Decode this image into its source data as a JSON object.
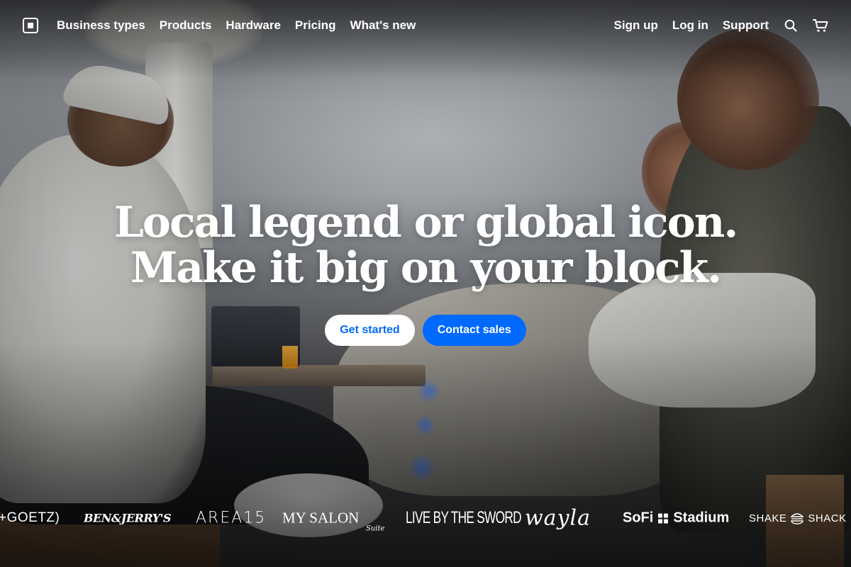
{
  "nav": {
    "logo_name": "square-logo",
    "primary": [
      {
        "label": "Business types"
      },
      {
        "label": "Products"
      },
      {
        "label": "Hardware"
      },
      {
        "label": "Pricing"
      },
      {
        "label": "What's new"
      }
    ],
    "secondary": [
      {
        "label": "Sign up"
      },
      {
        "label": "Log in"
      },
      {
        "label": "Support"
      }
    ],
    "icons": [
      "search-icon",
      "cart-icon"
    ]
  },
  "hero": {
    "headline_line1": "Local legend or global icon.",
    "headline_line2": "Make it big on your block.",
    "cta_primary": "Get started",
    "cta_secondary": "Contact sales"
  },
  "logos": {
    "goetz": "+GOETZ)",
    "benjerry": "BEN&JERRY'S",
    "area15": "AREA15",
    "mysalon": "MY SALON",
    "mysalon_sub": "Suite",
    "livebythesword": "LIVE BY THE SWORD",
    "wayla": "wayla",
    "sofi_a": "SoFi",
    "sofi_b": "Stadium",
    "shake_a": "SHAKE",
    "shake_b": "SHACK"
  },
  "colors": {
    "brand_blue": "#006aff",
    "text": "#ffffff"
  }
}
